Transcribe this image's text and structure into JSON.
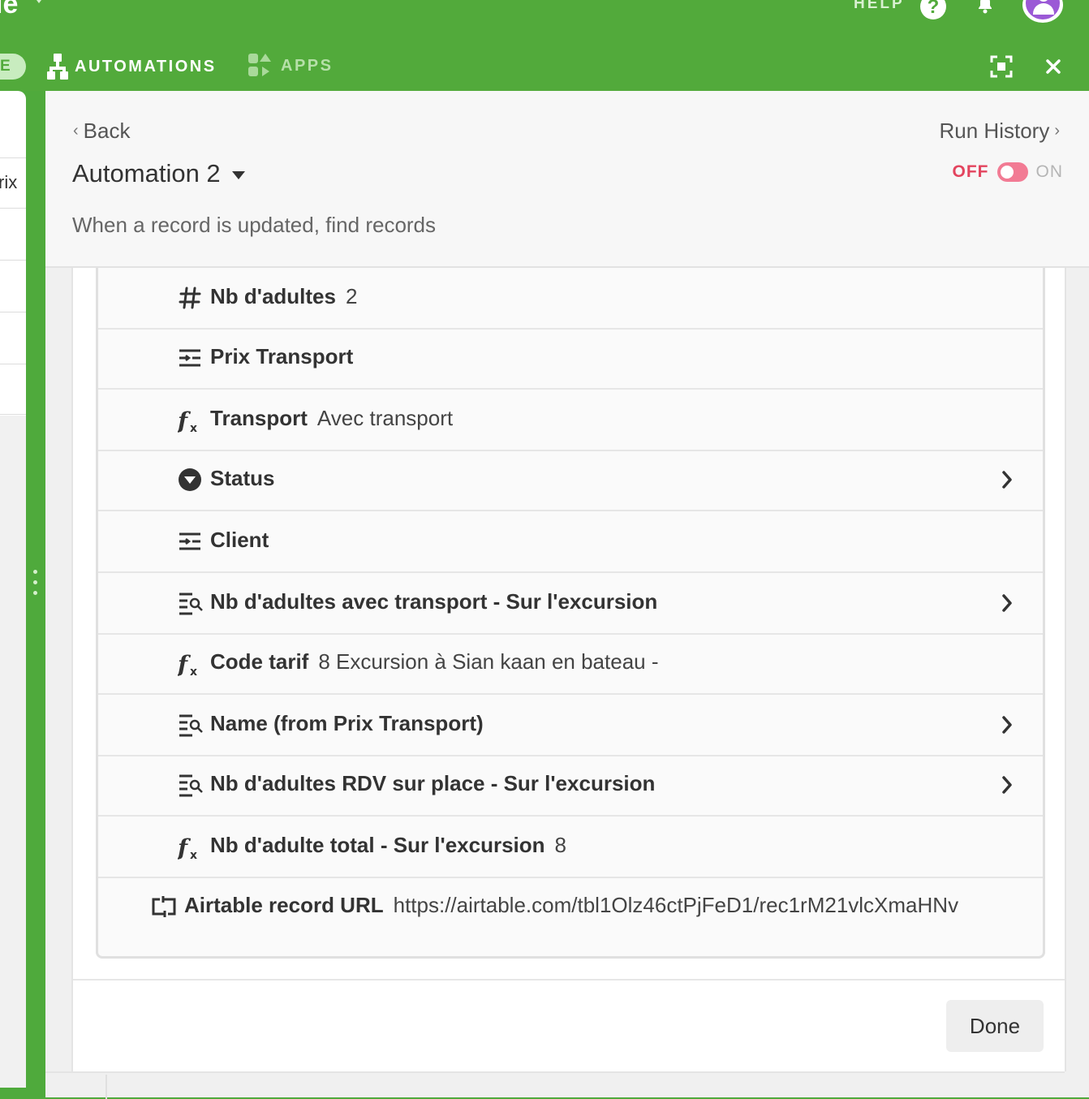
{
  "topbar": {
    "base_name": "le",
    "help_label": "HELP",
    "help_icon_glyph": "?",
    "tabs": [
      {
        "label": "E"
      },
      {
        "label": "AUTOMATIONS",
        "icon": "automations-icon"
      },
      {
        "label": "APPS",
        "icon": "apps-icon"
      }
    ]
  },
  "grid_peek": {
    "cell_text": "rix"
  },
  "panel": {
    "back_label": "Back",
    "run_history_label": "Run History",
    "title": "Automation 2",
    "toggle": {
      "off_label": "OFF",
      "on_label": "ON",
      "state": "off"
    },
    "subtitle": "When a record is updated, find records"
  },
  "fields": [
    {
      "icon": "number-icon",
      "name": "Nb d'adultes",
      "value": "2",
      "expandable": false
    },
    {
      "icon": "linked-record-icon",
      "name": "Prix Transport",
      "value": "",
      "expandable": false
    },
    {
      "icon": "formula-icon",
      "name": "Transport",
      "value": "Avec transport",
      "expandable": false
    },
    {
      "icon": "single-select-icon",
      "name": "Status",
      "value": "",
      "expandable": true
    },
    {
      "icon": "linked-record-icon",
      "name": "Client",
      "value": "",
      "expandable": false
    },
    {
      "icon": "lookup-icon",
      "name": "Nb d'adultes avec transport - Sur l'excursion",
      "value": "",
      "expandable": true
    },
    {
      "icon": "formula-icon",
      "name": "Code tarif",
      "value": "8 Excursion à Sian kaan en bateau -",
      "expandable": false
    },
    {
      "icon": "lookup-icon",
      "name": "Name (from Prix Transport)",
      "value": "",
      "expandable": true
    },
    {
      "icon": "lookup-icon",
      "name": "Nb d'adultes RDV sur place - Sur l'excursion",
      "value": "",
      "expandable": true
    },
    {
      "icon": "formula-icon",
      "name": "Nb d'adulte total - Sur l'excursion",
      "value": "8",
      "expandable": false
    },
    {
      "icon": "link-url-icon",
      "name": "Airtable record URL",
      "value": "https://airtable.com/tbl1Olz46ctPjFeD1/rec1rM21vlcXmaHNv",
      "expandable": false
    }
  ],
  "done_label": "Done",
  "colors": {
    "brand_green": "#52aa3b",
    "toggle_off": "#e3445e"
  }
}
